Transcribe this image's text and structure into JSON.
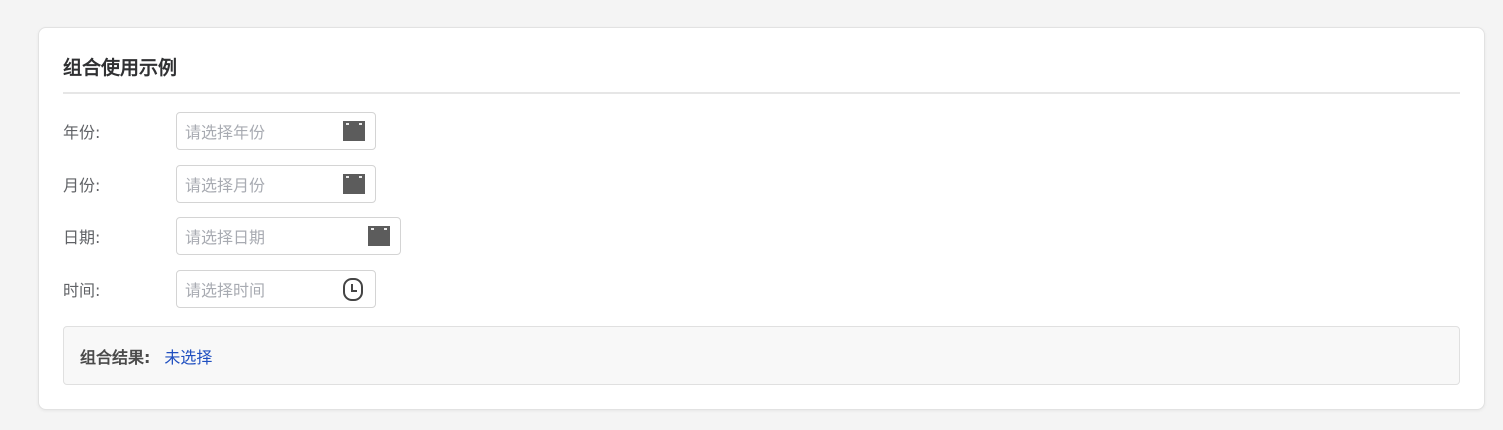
{
  "card": {
    "title": "组合使用示例"
  },
  "fields": {
    "year": {
      "label": "年份:",
      "placeholder": "请选择年份",
      "icon": "calendar-icon"
    },
    "month": {
      "label": "月份:",
      "placeholder": "请选择月份",
      "icon": "calendar-icon"
    },
    "date": {
      "label": "日期:",
      "placeholder": "请选择日期",
      "icon": "calendar-icon"
    },
    "time": {
      "label": "时间:",
      "placeholder": "请选择时间",
      "icon": "clock-icon"
    }
  },
  "result": {
    "label": "组合结果:",
    "value": "未选择"
  },
  "colors": {
    "accent": "#1f4fc0",
    "placeholder": "#a8abb2",
    "label": "#606266"
  }
}
